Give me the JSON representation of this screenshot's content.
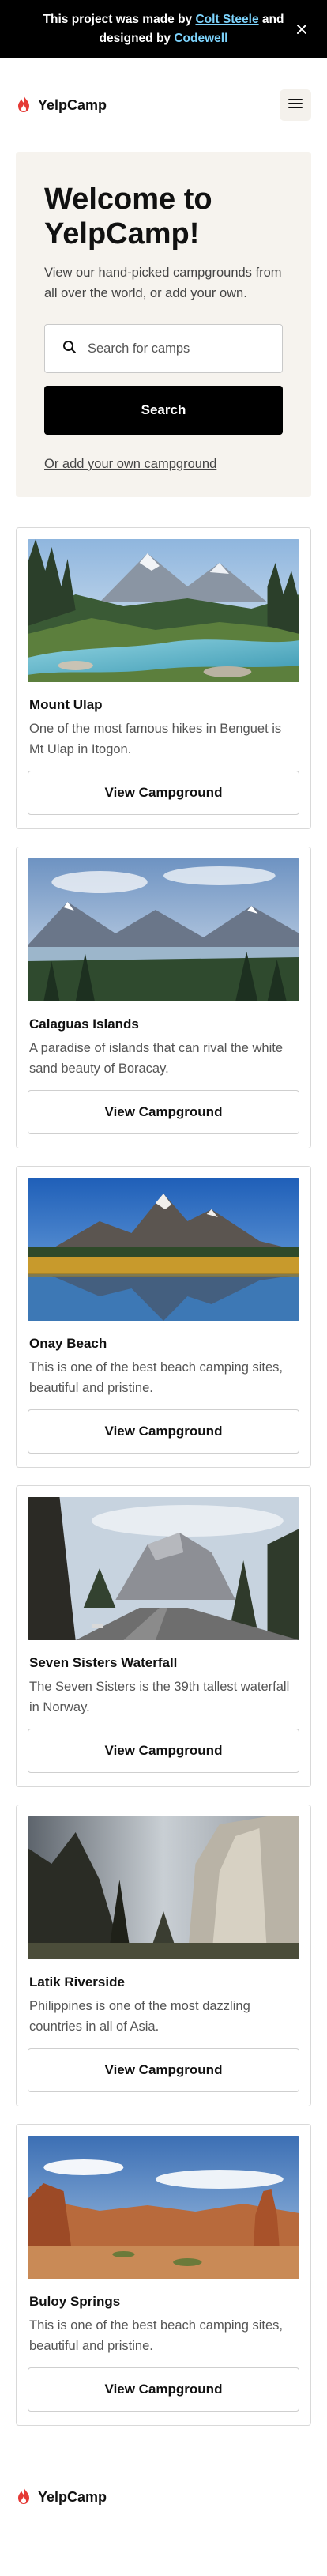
{
  "banner": {
    "text_before": "This project was made by ",
    "author_link": "Colt Steele",
    "text_middle": " and designed by ",
    "designer_link": "Codewell"
  },
  "header": {
    "logo_text": "YelpCamp"
  },
  "hero": {
    "title": "Welcome to YelpCamp!",
    "subtitle": "View our hand-picked campgrounds from all over the world, or add your own.",
    "search_placeholder": "Search for camps",
    "search_button": "Search",
    "add_link": "Or add your own campground"
  },
  "campgrounds": [
    {
      "name": "Mount Ulap",
      "description": "One of the most famous hikes in Benguet is Mt Ulap in Itogon.",
      "button": "View Campground",
      "image": "mountain-river"
    },
    {
      "name": "Calaguas Islands",
      "description": "A paradise of islands that can rival the white sand beauty of Boracay.",
      "button": "View Campground",
      "image": "lake-valley"
    },
    {
      "name": "Onay Beach",
      "description": "This is one of the best beach camping sites, beautiful and pristine.",
      "button": "View Campground",
      "image": "mountain-lake-reflection"
    },
    {
      "name": "Seven Sisters Waterfall",
      "description": "The Seven Sisters is the 39th tallest waterfall in Norway.",
      "button": "View Campground",
      "image": "half-dome-road"
    },
    {
      "name": "Latik Riverside",
      "description": "Philippines is one of the most dazzling countries in all of Asia.",
      "button": "View Campground",
      "image": "el-capitan-trees"
    },
    {
      "name": "Buloy Springs",
      "description": "This is one of the best beach camping sites, beautiful and pristine.",
      "button": "View Campground",
      "image": "red-rock-desert"
    }
  ],
  "footer": {
    "logo_text": "YelpCamp"
  },
  "colors": {
    "banner_bg": "#000000",
    "link": "#7dd3fc",
    "hero_bg": "#f6f3ee",
    "logo_red": "#e53935"
  }
}
